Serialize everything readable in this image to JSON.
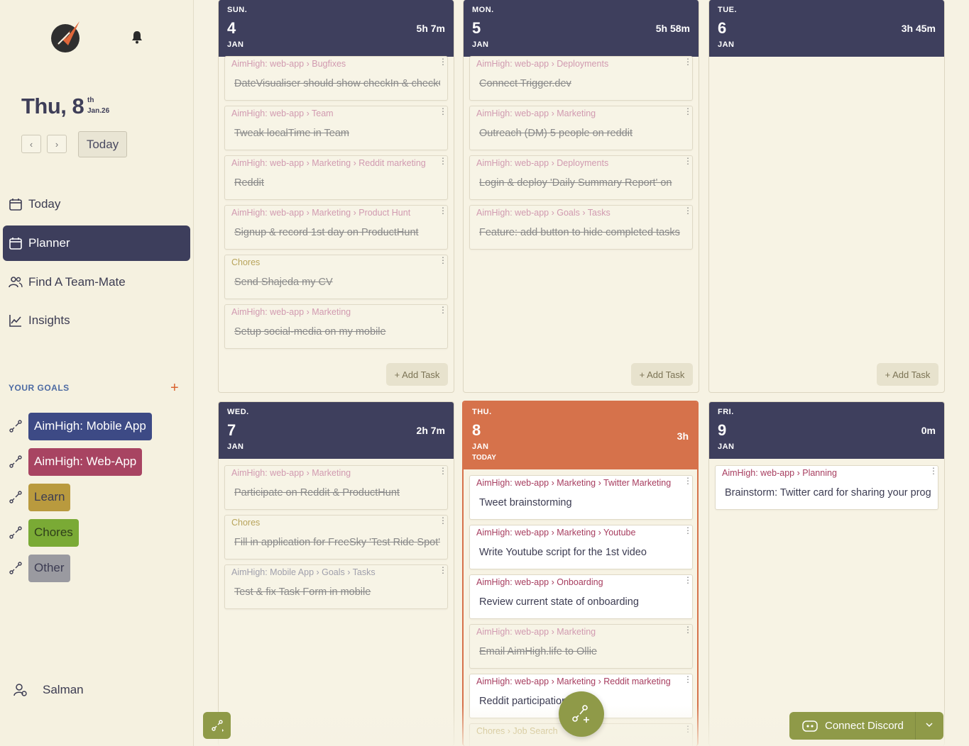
{
  "sidebar": {
    "date": {
      "main": "Thu, 8",
      "suffix": "th",
      "sub": "Jan.26"
    },
    "today_button": "Today",
    "prev_label": "‹",
    "next_label": "›",
    "nav": [
      {
        "label": "Today",
        "icon": "calendar-icon"
      },
      {
        "label": "Planner",
        "icon": "calendar-icon",
        "active": true
      },
      {
        "label": "Find A Team-Mate",
        "icon": "users-icon"
      },
      {
        "label": "Insights",
        "icon": "chart-line-icon"
      }
    ],
    "goals_title": "YOUR GOALS",
    "goals_add": "+",
    "goals": [
      {
        "label": "AimHigh: Mobile App",
        "bg": "#3d4a85",
        "fg": "#ffffff"
      },
      {
        "label": "AimHigh: Web-App",
        "bg": "#a84462",
        "fg": "#ffffff"
      },
      {
        "label": "Learn",
        "bg": "#b99a3e",
        "fg": "#3c3c52"
      },
      {
        "label": "Chores",
        "bg": "#7aaa35",
        "fg": "#2f3f1a"
      },
      {
        "label": "Other",
        "bg": "#9a9aa0",
        "fg": "#3c3c52"
      }
    ],
    "user": "Salman"
  },
  "days": [
    {
      "dow": "SUN.",
      "num": "4",
      "mon": "JAN",
      "hours": "5h 7m",
      "tasks": [
        {
          "path": "AimHigh: web-app › Bugfixes",
          "title": "DateVisualiser should show checkIn & checkOut",
          "done": true
        },
        {
          "path": "AimHigh: web-app › Team",
          "title": "Tweak localTime in Team",
          "done": true
        },
        {
          "path": "AimHigh: web-app › Marketing › Reddit marketing",
          "title": "Reddit",
          "done": true
        },
        {
          "path": "AimHigh: web-app › Marketing › Product Hunt",
          "title": "Signup & record 1st day on ProductHunt",
          "done": true
        },
        {
          "path": "Chores",
          "title": "Send Shajeda my CV",
          "done": true,
          "kind": "chores"
        },
        {
          "path": "AimHigh: web-app › Marketing",
          "title": "Setup social-media on my mobile",
          "done": true
        }
      ],
      "add_task": "+ Add Task"
    },
    {
      "dow": "MON.",
      "num": "5",
      "mon": "JAN",
      "hours": "5h 58m",
      "tasks": [
        {
          "path": "AimHigh: web-app › Deployments",
          "title": "Connect Trigger.dev",
          "done": true
        },
        {
          "path": "AimHigh: web-app › Marketing",
          "title": "Outreach (DM) 5 people on reddit",
          "done": true
        },
        {
          "path": "AimHigh: web-app › Deployments",
          "title": "Login & deploy 'Daily Summary Report' on",
          "done": true
        },
        {
          "path": "AimHigh: web-app › Goals › Tasks",
          "title": "Feature: add button to hide completed tasks",
          "done": true
        }
      ],
      "add_task": "+ Add Task"
    },
    {
      "dow": "TUE.",
      "num": "6",
      "mon": "JAN",
      "hours": "3h 45m",
      "tasks": [],
      "add_task": "+ Add Task"
    },
    {
      "dow": "WED.",
      "num": "7",
      "mon": "JAN",
      "hours": "2h 7m",
      "tasks": [
        {
          "path": "AimHigh: web-app › Marketing",
          "title": "Participate on  Reddit & ProductHunt",
          "done": true
        },
        {
          "path": "Chores",
          "title": "Fill in application for FreeSky 'Test Ride Spot'",
          "done": true,
          "kind": "chores"
        },
        {
          "path": "AimHigh: Mobile App › Goals › Tasks",
          "title": "Test & fix Task Form in mobile",
          "done": true,
          "kind": "mobile"
        }
      ]
    },
    {
      "dow": "THU.",
      "num": "8",
      "mon": "JAN",
      "hours": "3h",
      "today_tag": "TODAY",
      "today": true,
      "tasks": [
        {
          "path": "AimHigh: web-app › Marketing › Twitter Marketing",
          "title": "Tweet brainstorming",
          "done": false
        },
        {
          "path": "AimHigh: web-app › Marketing › Youtube",
          "title": "Write Youtube script for the 1st video",
          "done": false
        },
        {
          "path": "AimHigh: web-app › Onboarding",
          "title": "Review current state of onboarding",
          "done": false
        },
        {
          "path": "AimHigh: web-app › Marketing",
          "title": "Email AimHigh.life to Ollie",
          "done": true
        },
        {
          "path": "AimHigh: web-app › Marketing › Reddit marketing",
          "title": "Reddit participation",
          "done": false
        },
        {
          "path": "Chores › Job Search",
          "title": "",
          "done": true,
          "kind": "chores"
        }
      ]
    },
    {
      "dow": "FRI.",
      "num": "9",
      "mon": "JAN",
      "hours": "0m",
      "tasks": [
        {
          "path": "AimHigh: web-app › Planning",
          "title": "Brainstorm: Twitter card for sharing your progress",
          "done": false
        }
      ]
    }
  ],
  "discord_button": "Connect Discord",
  "colors": {
    "navy": "#3e3f5d",
    "orange": "#d6724b",
    "olive": "#8f9a48",
    "cream": "#f6f2e3"
  }
}
